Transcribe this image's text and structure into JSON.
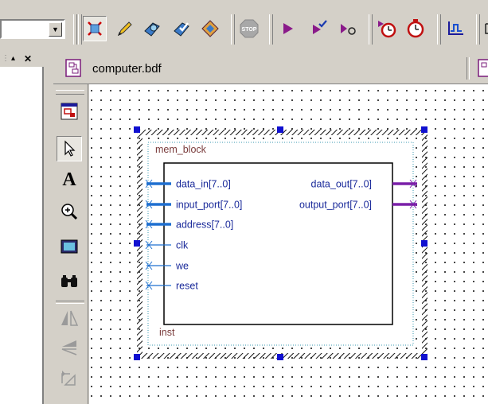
{
  "toolbar": {
    "combo_value": "",
    "buttons": [
      {
        "name": "selection-tool-icon",
        "active": true
      },
      {
        "name": "pencil-icon"
      },
      {
        "name": "compile-icon"
      },
      {
        "name": "analysis-icon"
      },
      {
        "name": "synthesis-icon"
      },
      {
        "name": "stop-icon",
        "label": "STOP"
      },
      {
        "name": "start-icon"
      },
      {
        "name": "run-checked-icon"
      },
      {
        "name": "step-icon"
      },
      {
        "name": "timer-start-icon"
      },
      {
        "name": "timer-icon"
      },
      {
        "name": "waveform-icon"
      }
    ]
  },
  "left_pane": {
    "controls": [
      "▴",
      "✕"
    ]
  },
  "document": {
    "tab_title": "computer.bdf"
  },
  "palette": {
    "tools": [
      "block-tool-icon",
      "pointer-tool-icon",
      "text-tool-icon",
      "zoom-tool-icon",
      "symbol-tool-icon",
      "find-tool-icon",
      "flip-horizontal-icon",
      "flip-vertical-icon",
      "rotate-icon"
    ]
  },
  "block": {
    "name": "mem_block",
    "instance": "inst",
    "inputs": [
      "data_in[7..0]",
      "input_port[7..0]",
      "address[7..0]",
      "clk",
      "we",
      "reset"
    ],
    "outputs": [
      "data_out[7..0]",
      "output_port[7..0]"
    ],
    "bus_inputs": [
      true,
      true,
      true,
      false,
      false,
      false
    ],
    "colors": {
      "bus_in": "#1e6fd0",
      "bus_out": "#7a1fa8",
      "pin_text": "#1a2a9a",
      "label": "#7a3c3c",
      "handle": "#1010d0"
    }
  }
}
